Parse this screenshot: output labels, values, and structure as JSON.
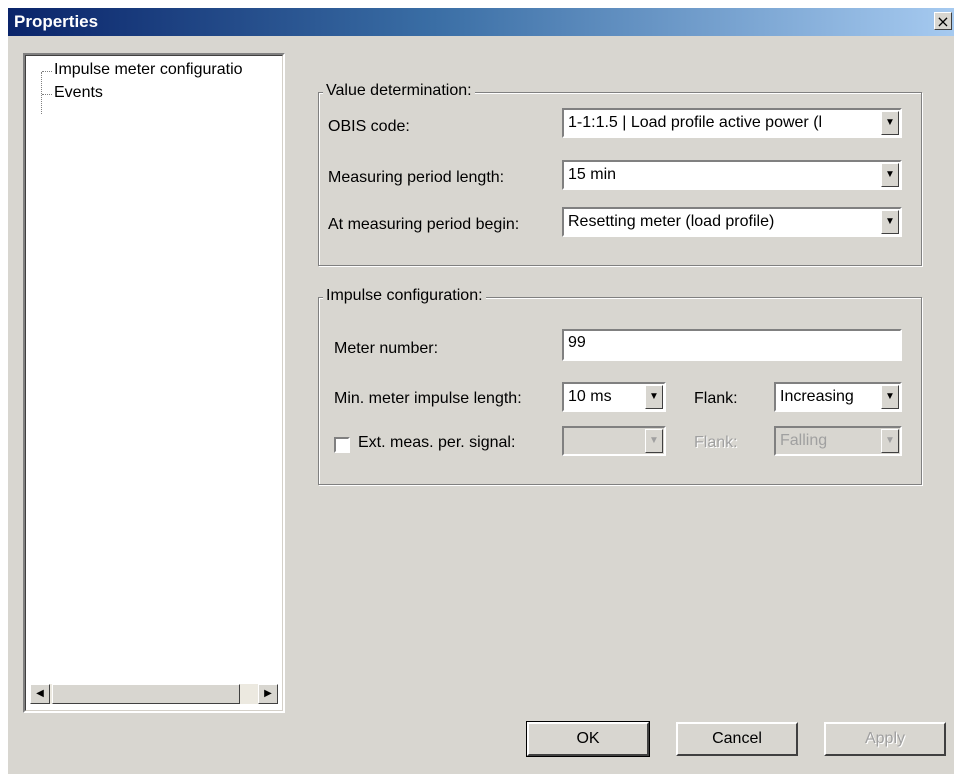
{
  "window": {
    "title": "Properties",
    "close_glyph": "×"
  },
  "tree": {
    "items": [
      {
        "label": "Impulse meter configuratio"
      },
      {
        "label": "Events"
      }
    ],
    "scroll_left": "◀",
    "scroll_right": "▶"
  },
  "value_determination": {
    "title": "Value determination:",
    "obis_label": "OBIS code:",
    "obis_value": "1-1:1.5 | Load profile active power (l",
    "period_label": "Measuring period length:",
    "period_value": "15 min",
    "begin_label": "At measuring period begin:",
    "begin_value": "Resetting meter (load profile)"
  },
  "impulse_configuration": {
    "title": "Impulse configuration:",
    "meter_number_label": "Meter number:",
    "meter_number_value": "99",
    "min_impulse_label": "Min. meter impulse length:",
    "min_impulse_value": "10 ms",
    "flank_label": "Flank:",
    "flank_value": "Increasing",
    "ext_signal_label": "Ext. meas. per. signal:",
    "ext_signal_checked": false,
    "ext_signal_value": "",
    "flank2_label": "Flank:",
    "flank2_value": "Falling"
  },
  "dropdown_glyph": "▼",
  "buttons": {
    "ok": "OK",
    "cancel": "Cancel",
    "apply": "Apply"
  }
}
